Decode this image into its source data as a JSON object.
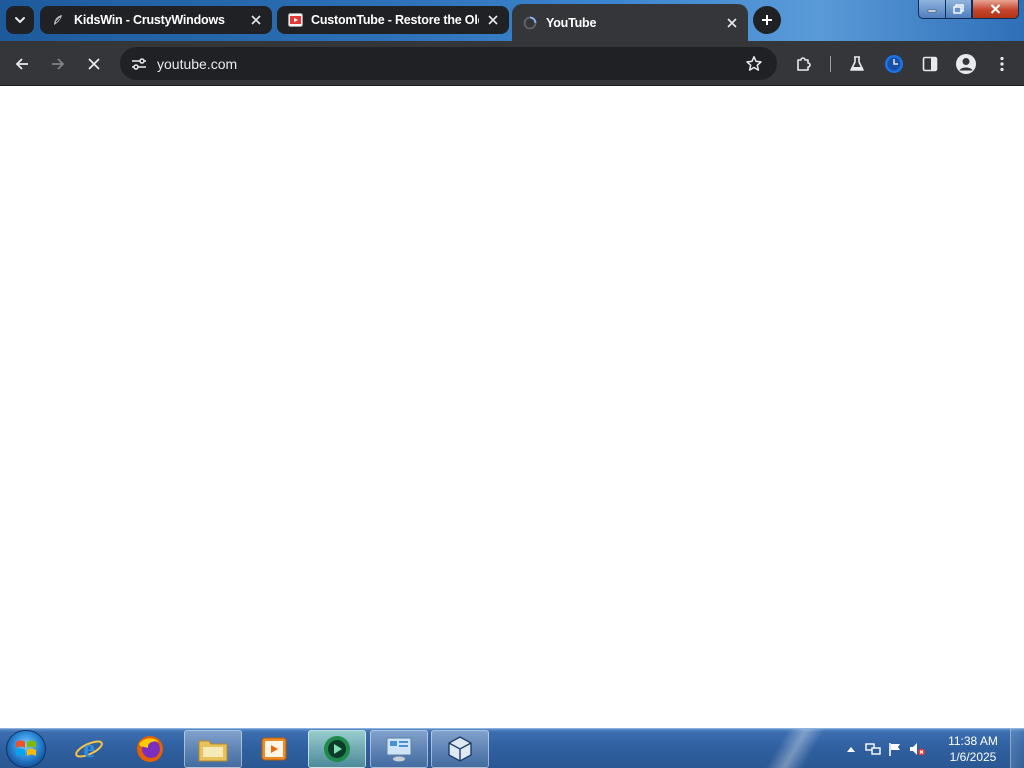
{
  "browser": {
    "tabs": [
      {
        "title": "KidsWin - CrustyWindows",
        "favicon": "kidswin-favicon-icon",
        "active": false
      },
      {
        "title": "CustomTube - Restore the Old",
        "favicon": "customtube-favicon-icon",
        "active": false
      },
      {
        "title": "YouTube",
        "favicon": "loading-spinner-icon",
        "active": true
      }
    ],
    "address": "youtube.com",
    "colors": {
      "frame": "#202124",
      "toolbar": "#35363a",
      "omnibox": "#202124",
      "text": "#e8eaed"
    }
  },
  "taskbar": {
    "apps": [
      {
        "name": "internet-explorer-icon"
      },
      {
        "name": "firefox-icon"
      },
      {
        "name": "windows-explorer-icon"
      },
      {
        "name": "media-player-icon"
      },
      {
        "name": "chrome-icon"
      },
      {
        "name": "remote-desktop-icon"
      },
      {
        "name": "virtualbox-icon"
      }
    ],
    "clock": {
      "time": "11:38 AM",
      "date": "1/6/2025"
    }
  }
}
